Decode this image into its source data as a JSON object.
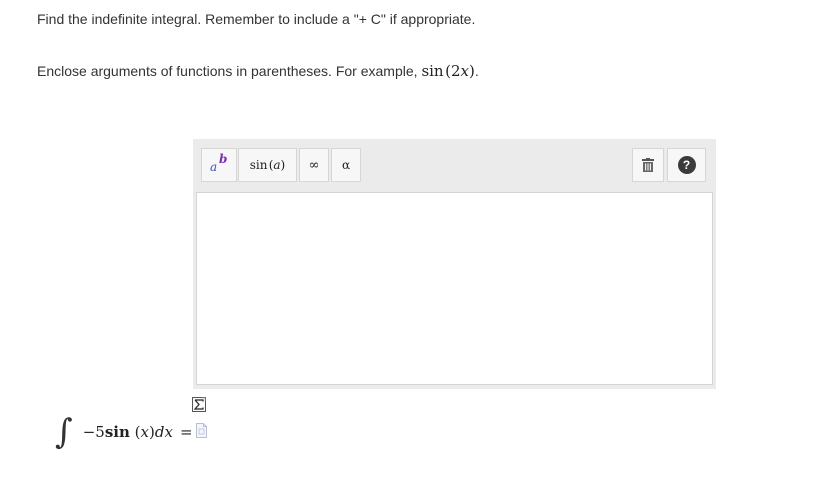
{
  "instructions": {
    "line1": "Find the indefinite integral. Remember to include a \"+ C\" if appropriate.",
    "line2_prefix": "Enclose arguments of functions in parentheses. For example, ",
    "line2_example_fn": "sin",
    "line2_example_arg": "(2",
    "line2_example_var": "x",
    "line2_example_close": ")",
    "line2_suffix": "."
  },
  "toolbar": {
    "power_base": "a",
    "power_exp": "b",
    "sin_fn": "sin",
    "sin_arg_open": "(",
    "sin_arg": "a",
    "sin_arg_close": ")",
    "infinity": "∞",
    "alpha": "α",
    "trash_icon": "trash-icon",
    "help_label": "?"
  },
  "input": {
    "value": ""
  },
  "problem": {
    "integral_sign": "∫",
    "coefficient": "−5",
    "function": "sin",
    "arg_open": " (",
    "variable": "x",
    "arg_close": ")",
    "differential_d": "d",
    "differential_var": "x",
    "equals": "="
  },
  "colors": {
    "panel_bg": "#ebebeb",
    "button_bg": "#f7f7f7",
    "power_base": "#3a4fb8",
    "power_exp": "#7b2fb5",
    "help_bg": "#3b3b3b"
  }
}
